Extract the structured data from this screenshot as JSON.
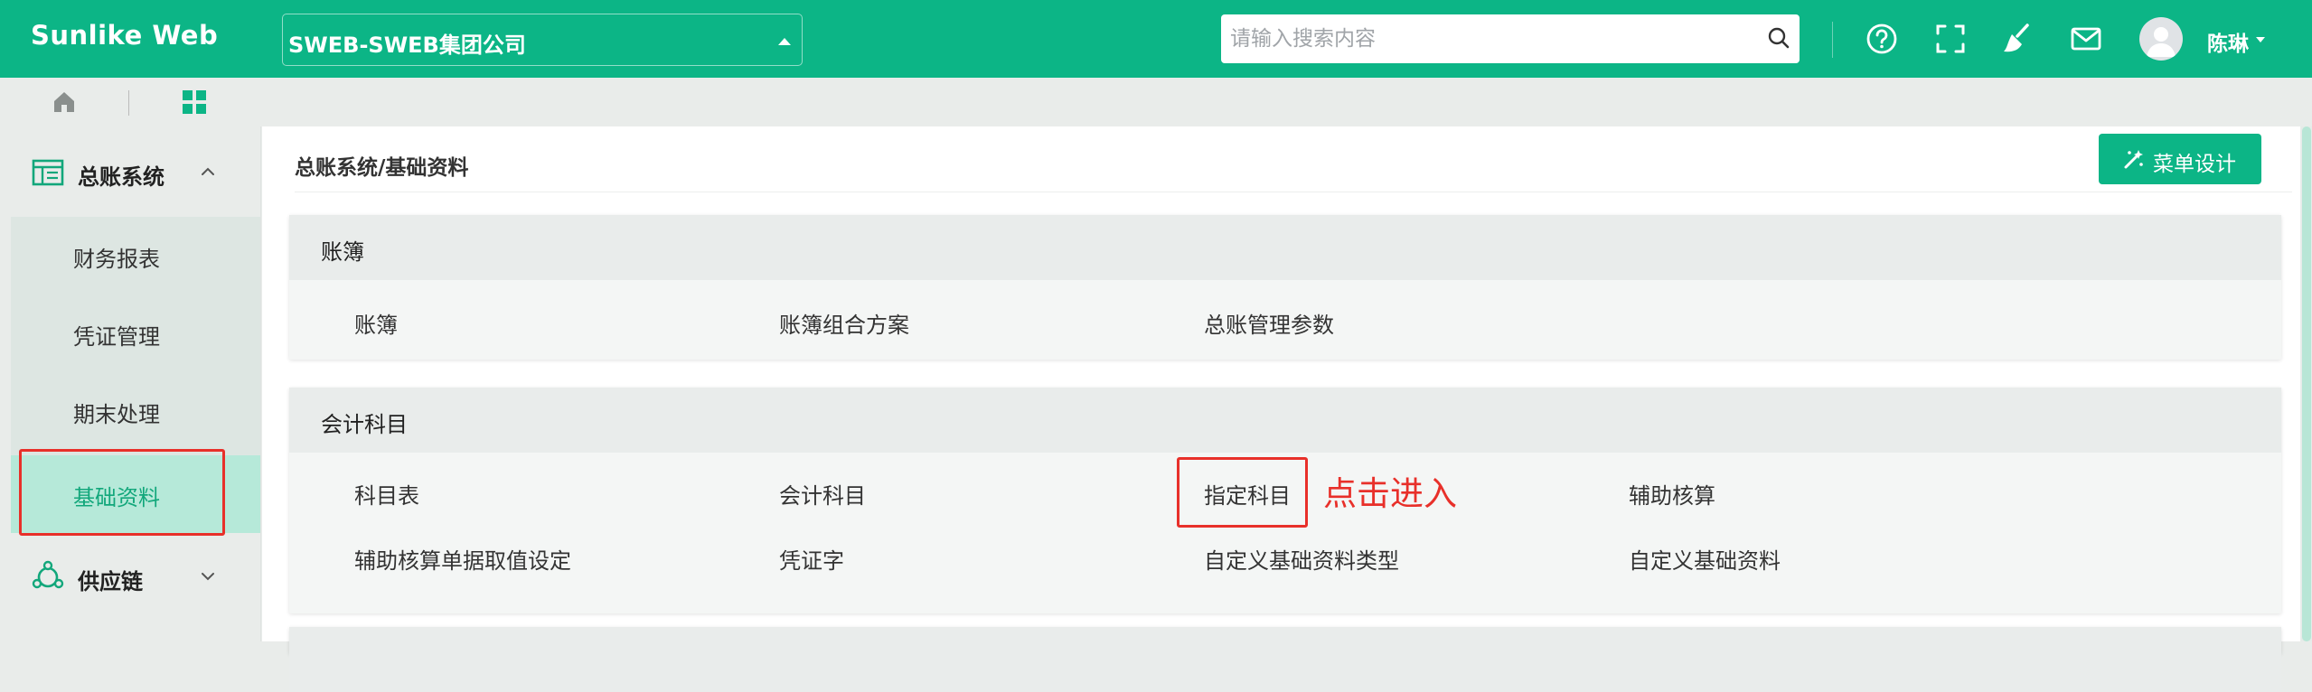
{
  "header": {
    "brand": "Sunlike Web",
    "company": "SWEB-SWEB集团公司",
    "search_placeholder": "请输入搜索内容",
    "user": "陈琳",
    "icons": [
      "help-icon",
      "fullscreen-icon",
      "clear-cache-icon",
      "mail-icon"
    ]
  },
  "sidebar": {
    "section_ledger": "总账系统",
    "items": [
      "财务报表",
      "凭证管理",
      "期末处理",
      "基础资料"
    ],
    "active_item": "基础资料",
    "section_supply": "供应链"
  },
  "main": {
    "breadcrumb": "总账系统/基础资料",
    "menu_button": "菜单设计",
    "panels": [
      {
        "title": "账簿",
        "links": [
          "账簿",
          "账簿组合方案",
          "总账管理参数"
        ]
      },
      {
        "title": "会计科目",
        "links": [
          "科目表",
          "会计科目",
          "指定科目",
          "辅助核算",
          "辅助核算单据取值设定",
          "凭证字",
          "自定义基础资料类型",
          "自定义基础资料"
        ]
      }
    ],
    "annotation": "点击进入"
  },
  "colors": {
    "brand_green": "#0cb586",
    "active_bg": "#b6e9d9",
    "highlight_red": "#e8302a"
  }
}
